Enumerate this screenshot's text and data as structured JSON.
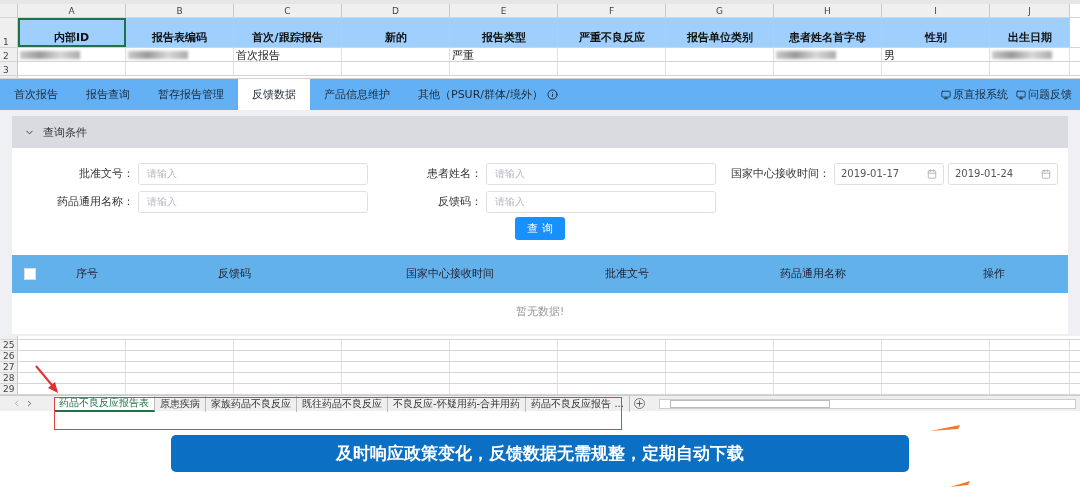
{
  "spreadsheet": {
    "columns": [
      "A",
      "B",
      "C",
      "D",
      "E",
      "F",
      "G",
      "H",
      "I",
      "J"
    ],
    "header_row": {
      "number": "1",
      "cells": [
        "内部ID",
        "报告表编码",
        "首次/跟踪报告",
        "新的",
        "报告类型",
        "严重不良反应",
        "报告单位类别",
        "患者姓名首字母",
        "性别",
        "出生日期"
      ]
    },
    "rows": [
      {
        "number": "2",
        "cells": [
          {
            "kind": "redacted"
          },
          {
            "kind": "redacted"
          },
          {
            "kind": "text",
            "text": "首次报告"
          },
          {
            "kind": "empty"
          },
          {
            "kind": "text",
            "text": "严重"
          },
          {
            "kind": "empty"
          },
          {
            "kind": "empty"
          },
          {
            "kind": "redacted"
          },
          {
            "kind": "text",
            "text": "男"
          },
          {
            "kind": "redacted"
          }
        ]
      },
      {
        "number": "3",
        "cells": [
          {
            "kind": "empty"
          },
          {
            "kind": "empty"
          },
          {
            "kind": "empty"
          },
          {
            "kind": "empty"
          },
          {
            "kind": "empty"
          },
          {
            "kind": "empty"
          },
          {
            "kind": "empty"
          },
          {
            "kind": "empty"
          },
          {
            "kind": "empty"
          },
          {
            "kind": "empty"
          }
        ]
      }
    ],
    "bottom_rows": [
      "25",
      "26",
      "27",
      "28",
      "29"
    ],
    "sheet_tabs": [
      {
        "label": "药品不良反应报告表",
        "selected": true
      },
      {
        "label": "原患疾病",
        "selected": false
      },
      {
        "label": "家族药品不良反应",
        "selected": false
      },
      {
        "label": "既往药品不良反应",
        "selected": false
      },
      {
        "label": "不良反应-怀疑用药-合并用药",
        "selected": false
      },
      {
        "label": "药品不良反应报告 ...",
        "selected": false
      }
    ]
  },
  "app": {
    "nav_tabs": [
      {
        "label": "首次报告",
        "selected": false
      },
      {
        "label": "报告查询",
        "selected": false
      },
      {
        "label": "暂存报告管理",
        "selected": false
      },
      {
        "label": "反馈数据",
        "selected": true
      },
      {
        "label": "产品信息维护",
        "selected": false
      },
      {
        "label": "其他（PSUR/群体/境外）",
        "selected": false
      }
    ],
    "nav_links": [
      "原直报系统",
      "问题反馈"
    ],
    "query_panel": {
      "title": "查询条件",
      "expanded": true,
      "fields": [
        {
          "label": "批准文号：",
          "placeholder": "请输入"
        },
        {
          "label": "患者姓名：",
          "placeholder": "请输入"
        },
        {
          "label": "药品通用名称：",
          "placeholder": "请输入"
        },
        {
          "label": "反馈码：",
          "placeholder": "请输入"
        }
      ],
      "date_range": {
        "label": "国家中心接收时间：",
        "start": "2019-01-17",
        "end": "2019-01-24"
      },
      "button": "查 询"
    },
    "table": {
      "columns": [
        "序号",
        "反馈码",
        "国家中心接收时间",
        "批准文号",
        "药品通用名称",
        "操作"
      ],
      "select_all": {
        "checked": false
      },
      "empty_text": "暂无数据!"
    }
  },
  "banner": "及时响应政策变化，反馈数据无需规整，定期自动下载"
}
